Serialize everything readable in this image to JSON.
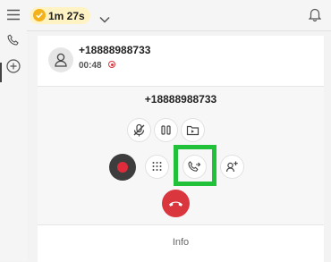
{
  "topbar": {
    "menu_icon": "hamburger-menu-icon",
    "status_icon": "check-circle-icon",
    "timer": "1m 27s",
    "dropdown_icon": "chevron-down-icon",
    "notification_icon": "bell-icon"
  },
  "sidebar": {
    "items": [
      {
        "icon": "phone-icon"
      },
      {
        "icon": "add-circle-icon"
      }
    ]
  },
  "call": {
    "caller_number": "+18888988733",
    "duration": "00:48",
    "recording_indicator": "recording-icon",
    "panel_number": "+18888988733"
  },
  "controls": {
    "row1": [
      "mute-microphone-icon",
      "hold-pause-icon",
      "park-folder-icon"
    ],
    "row2": [
      "record-icon",
      "keypad-icon",
      "transfer-call-icon",
      "add-participant-icon"
    ],
    "hangup": "end-call-icon",
    "highlighted": "transfer-call-icon"
  },
  "tabs": {
    "info_label": "Info"
  },
  "colors": {
    "timer_pill": "#fff3c4",
    "status_check": "#f3b21b",
    "record_red": "#e02b3b",
    "hangup_red": "#d9363e",
    "highlight_green": "#21c23a"
  }
}
